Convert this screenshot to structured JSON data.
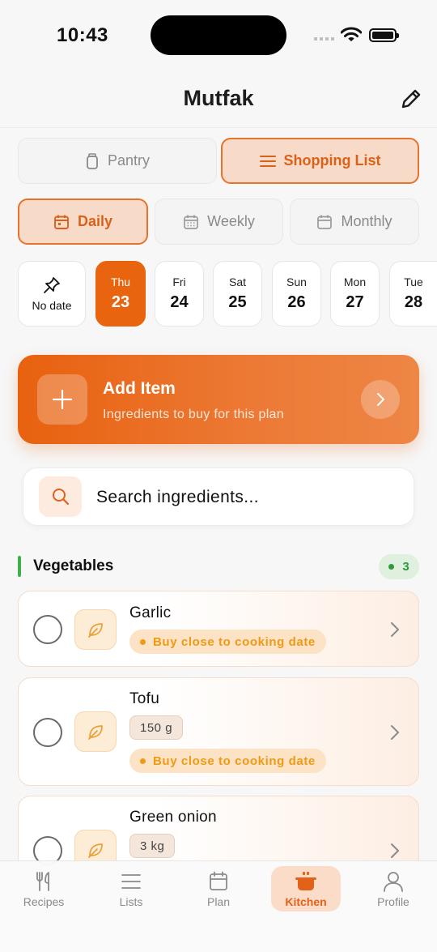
{
  "status": {
    "time": "10:43"
  },
  "header": {
    "title": "Mutfak"
  },
  "mode_tabs": [
    {
      "label": "Pantry",
      "active": false
    },
    {
      "label": "Shopping List",
      "active": true
    }
  ],
  "period_tabs": [
    {
      "label": "Daily",
      "active": true
    },
    {
      "label": "Weekly",
      "active": false
    },
    {
      "label": "Monthly",
      "active": false
    }
  ],
  "days": {
    "no_date": "No date",
    "list": [
      {
        "name": "Thu",
        "num": "23",
        "active": true
      },
      {
        "name": "Fri",
        "num": "24"
      },
      {
        "name": "Sat",
        "num": "25"
      },
      {
        "name": "Sun",
        "num": "26"
      },
      {
        "name": "Mon",
        "num": "27"
      },
      {
        "name": "Tue",
        "num": "28"
      }
    ]
  },
  "add_item": {
    "title": "Add Item",
    "subtitle": "Ingredients to buy for this plan"
  },
  "search": {
    "placeholder": "Search ingredients..."
  },
  "section": {
    "title": "Vegetables",
    "count": "3"
  },
  "items": [
    {
      "name": "Garlic",
      "tip": "Buy close to cooking date"
    },
    {
      "name": "Tofu",
      "qty": "150 g",
      "tip": "Buy close to cooking date"
    },
    {
      "name": "Green onion",
      "qty": "3 kg"
    }
  ],
  "tabbar": [
    {
      "label": "Recipes",
      "icon": "fork-knife-icon"
    },
    {
      "label": "Lists",
      "icon": "list-icon"
    },
    {
      "label": "Plan",
      "icon": "calendar-icon"
    },
    {
      "label": "Kitchen",
      "icon": "pot-icon",
      "active": true
    },
    {
      "label": "Profile",
      "icon": "person-icon"
    }
  ],
  "colors": {
    "accent": "#e8640f",
    "accent_soft": "#f8dac9",
    "green": "#2e9a3b",
    "tip": "#ee9a14"
  }
}
